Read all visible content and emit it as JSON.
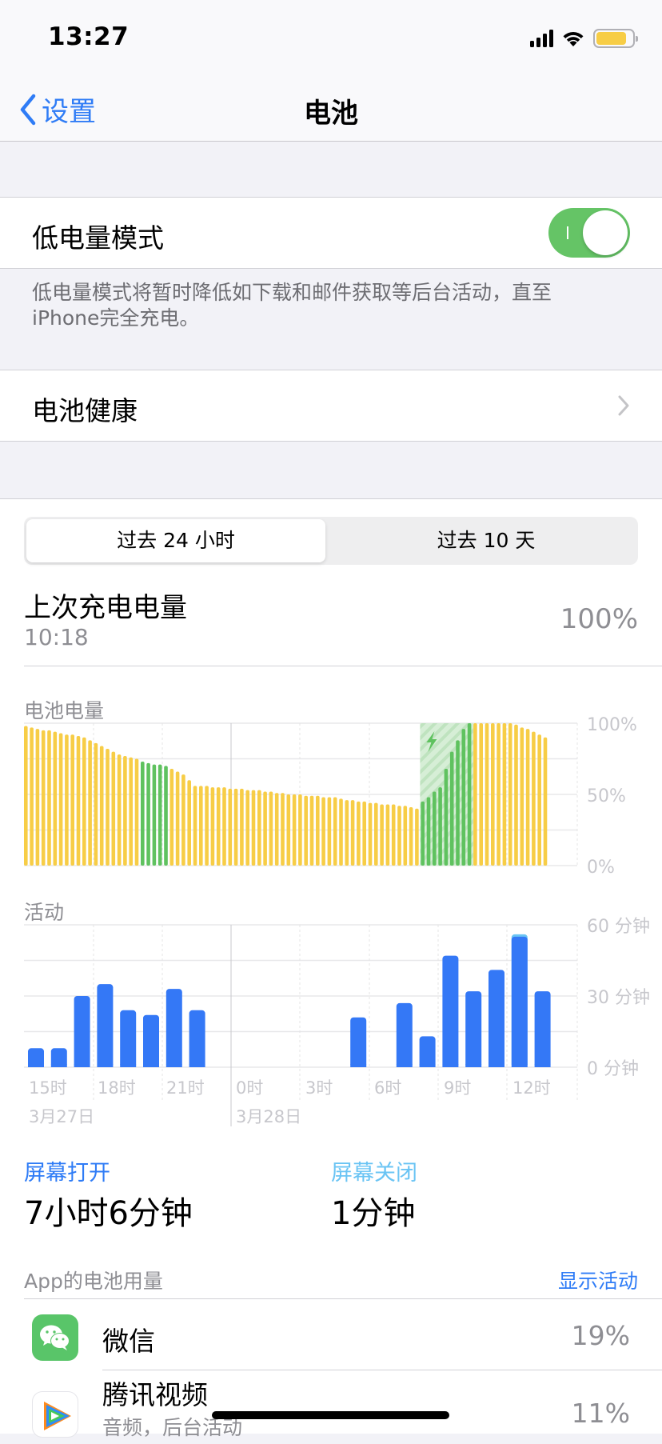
{
  "status_bar": {
    "time": "13:27",
    "battery_level": 0.85
  },
  "nav": {
    "back_label": "设置",
    "title": "电池"
  },
  "low_power": {
    "label": "低电量模式",
    "enabled": true,
    "footnote": "低电量模式将暂时降低如下载和邮件获取等后台活动，直至iPhone完全充电。"
  },
  "battery_health": {
    "label": "电池健康"
  },
  "segmented": {
    "options": [
      "过去 24 小时",
      "过去 10 天"
    ],
    "selected": 0
  },
  "last_charge": {
    "label": "上次充电电量",
    "time": "10:18",
    "value": "100%"
  },
  "colors": {
    "accent": "#2f7cf6",
    "battery_yellow": "#f7cd46",
    "charging_green": "#5fc25f",
    "screen_on": "#3478f6",
    "screen_off": "#6ac4f4"
  },
  "chart_data": [
    {
      "type": "bar",
      "title": "电池电量",
      "ylabel": "",
      "y_ticks": [
        "100%",
        "50%",
        "0%"
      ],
      "ylim": [
        0,
        100
      ],
      "series": [
        {
          "name": "battery_level",
          "values": [
            98,
            97,
            96,
            95,
            95,
            94,
            93,
            92,
            92,
            91,
            90,
            88,
            86,
            84,
            82,
            80,
            78,
            77,
            76,
            75,
            73,
            72,
            71,
            71,
            70,
            68,
            66,
            64,
            60,
            56,
            56,
            56,
            55,
            55,
            55,
            54,
            54,
            54,
            53,
            53,
            53,
            52,
            52,
            51,
            51,
            50,
            50,
            50,
            49,
            49,
            49,
            48,
            48,
            48,
            47,
            46,
            46,
            45,
            45,
            44,
            44,
            43,
            43,
            43,
            42,
            42,
            41,
            40,
            45,
            48,
            52,
            55,
            68,
            80,
            88,
            96,
            100,
            100,
            100,
            100,
            100,
            100,
            100,
            100,
            99,
            97,
            96,
            94,
            92,
            90
          ],
          "state": [
            "d",
            "d",
            "d",
            "d",
            "d",
            "d",
            "d",
            "d",
            "d",
            "d",
            "d",
            "d",
            "d",
            "d",
            "d",
            "d",
            "d",
            "d",
            "d",
            "d",
            "c",
            "c",
            "c",
            "c",
            "c",
            "d",
            "d",
            "d",
            "d",
            "d",
            "d",
            "d",
            "d",
            "d",
            "d",
            "d",
            "d",
            "d",
            "d",
            "d",
            "d",
            "d",
            "d",
            "d",
            "d",
            "d",
            "d",
            "d",
            "d",
            "d",
            "d",
            "d",
            "d",
            "d",
            "d",
            "d",
            "d",
            "d",
            "d",
            "d",
            "d",
            "d",
            "d",
            "d",
            "d",
            "d",
            "d",
            "d",
            "c",
            "c",
            "c",
            "c",
            "c",
            "c",
            "c",
            "c",
            "c",
            "d",
            "d",
            "d",
            "d",
            "d",
            "d",
            "d",
            "d",
            "d",
            "d",
            "d",
            "d",
            "d"
          ]
        }
      ],
      "charging_window_start_index": 67,
      "charging_window_end_index": 76
    },
    {
      "type": "bar",
      "title": "活动",
      "y_ticks": [
        "60 分钟",
        "30 分钟",
        "0 分钟"
      ],
      "ylim": [
        0,
        60
      ],
      "x_tick_labels": [
        "15时",
        "18时",
        "21时",
        "0时",
        "3时",
        "6时",
        "9时",
        "12时"
      ],
      "date_labels": [
        "3月27日",
        "3月28日"
      ],
      "categories": [
        "14",
        "15",
        "16",
        "17",
        "18",
        "19",
        "20",
        "21",
        "22",
        "23",
        "0",
        "1",
        "2",
        "3",
        "4",
        "5",
        "6",
        "7",
        "8",
        "9",
        "10",
        "11",
        "12"
      ],
      "series": [
        {
          "name": "屏幕打开",
          "values": [
            8,
            8,
            30,
            35,
            24,
            22,
            33,
            24,
            0,
            0,
            0,
            0,
            0,
            0,
            21,
            0,
            27,
            13,
            47,
            32,
            41,
            55,
            32
          ]
        },
        {
          "name": "屏幕关闭",
          "values": [
            0,
            0,
            0,
            0,
            0,
            0,
            0,
            0,
            0,
            0,
            0,
            0,
            0,
            0,
            0,
            0,
            0,
            0,
            0,
            0,
            0,
            1,
            0
          ]
        }
      ]
    }
  ],
  "screen_on": {
    "label": "屏幕打开",
    "value": "7小时6分钟"
  },
  "screen_off": {
    "label": "屏幕关闭",
    "value": "1分钟"
  },
  "app_usage": {
    "header": "App的电池用量",
    "show_activity": "显示活动",
    "apps": [
      {
        "name": "微信",
        "subtitle": "",
        "percent": "19%",
        "icon": "wechat-icon"
      },
      {
        "name": "腾讯视频",
        "subtitle": "音频，后台活动",
        "percent": "11%",
        "icon": "tencent-video-icon"
      }
    ]
  }
}
